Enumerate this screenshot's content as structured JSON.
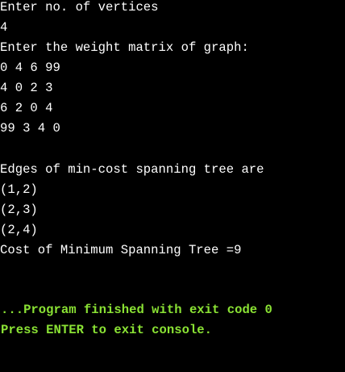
{
  "console": {
    "background": "#000000",
    "text_color": "#ffffff",
    "status_color": "#8ae234",
    "prompt_vertices": "Enter no. of vertices",
    "input_vertices": "4",
    "prompt_matrix": "Enter the weight matrix of graph:",
    "matrix_rows": [
      "0 4 6 99",
      "4 0 2 3",
      "6 2 0 4",
      "99 3 4 0"
    ],
    "edges_header": "Edges of min-cost spanning tree are",
    "edges": [
      "(1,2)",
      "(2,3)",
      "(2,4)"
    ],
    "cost_line": "Cost of Minimum Spanning Tree =9",
    "finished_message": "...Program finished with exit code 0",
    "exit_prompt": "Press ENTER to exit console."
  }
}
